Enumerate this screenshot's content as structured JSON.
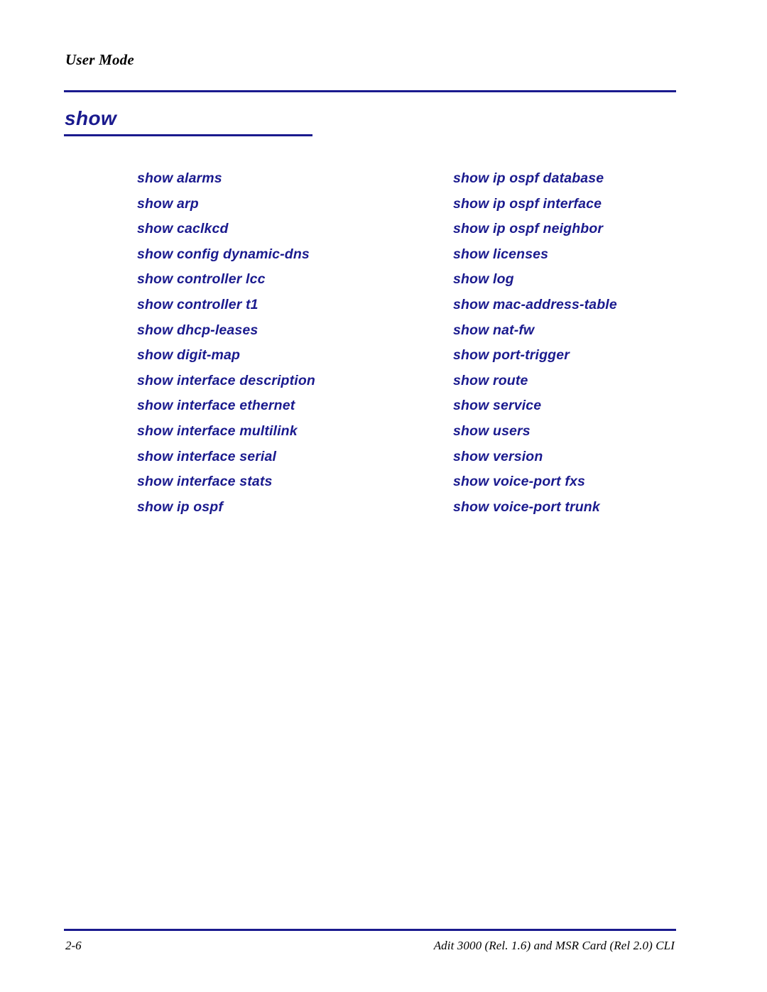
{
  "page": {
    "running_head": "User Mode",
    "section_title": "show",
    "accent_color": "#1a1a8e",
    "text_color": "#000000"
  },
  "commands": {
    "left_column": [
      "show alarms",
      "show arp",
      "show caclkcd",
      "show config dynamic-dns",
      "show controller lcc",
      "show controller t1",
      "show dhcp-leases",
      "show digit-map",
      "show interface description",
      "show interface ethernet",
      "show interface multilink",
      "show interface serial",
      "show interface stats",
      "show ip ospf"
    ],
    "right_column": [
      "show ip ospf database",
      "show ip ospf interface",
      "show ip ospf neighbor",
      "show licenses",
      "show log",
      "show mac-address-table",
      "show nat-fw",
      "show port-trigger",
      "show route",
      "show service",
      "show users",
      "show version",
      "show voice-port fxs",
      "show voice-port trunk"
    ]
  },
  "footer": {
    "page_number": "2-6",
    "document_id": "Adit 3000 (Rel. 1.6) and MSR Card (Rel 2.0) CLI"
  }
}
